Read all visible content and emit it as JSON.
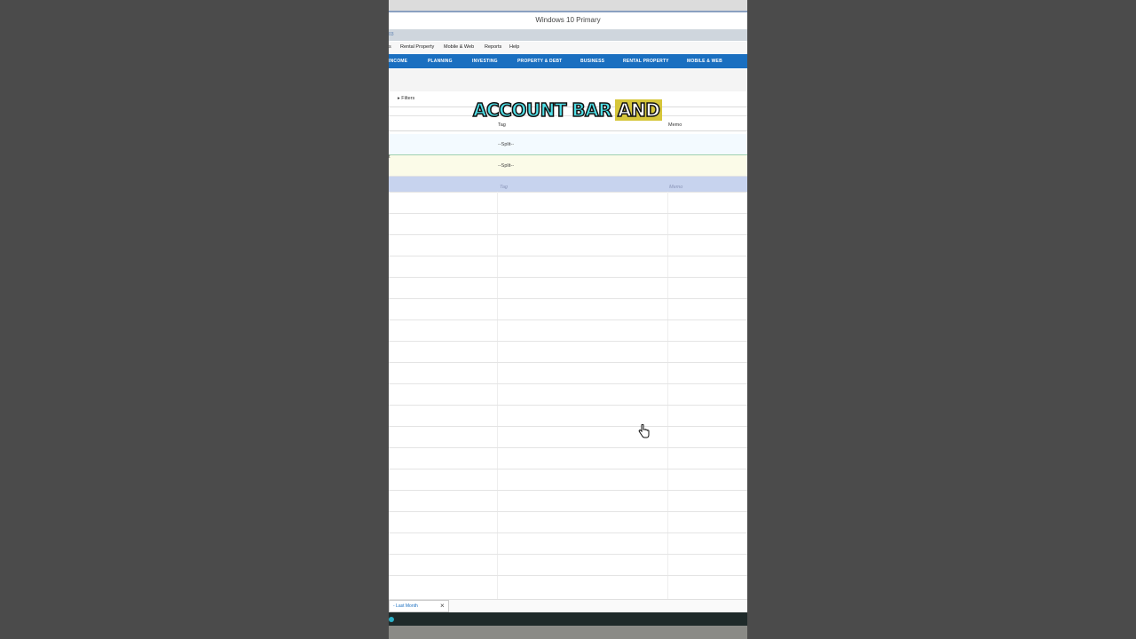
{
  "window": {
    "title": "Windows 10 Primary"
  },
  "menu": {
    "items": [
      "s",
      "Rental Property",
      "Mobile & Web",
      "Reports",
      "Help"
    ],
    "grey_text": "03"
  },
  "nav": {
    "tabs": [
      "INCOME",
      "PLANNING",
      "INVESTING",
      "PROPERTY & DEBT",
      "BUSINESS",
      "RENTAL PROPERTY",
      "MOBILE & WEB"
    ]
  },
  "filters": {
    "label": "Filters"
  },
  "register": {
    "columns": {
      "tag": "Tag",
      "memo": "Memo"
    },
    "rows": [
      {
        "tag": "--Split--",
        "left_mark": ""
      },
      {
        "tag": "--Split--",
        "left_mark": "t"
      }
    ],
    "new_row": {
      "tag": "Tag",
      "memo": "Memo"
    }
  },
  "footer": {
    "tab_label": "- Last Month",
    "close": "×"
  },
  "caption": {
    "word1": "ACCOUNT BAR",
    "word2": "AND"
  },
  "colors": {
    "nav_blue": "#1a6fc0",
    "caption_cyan": "#4fe0e8",
    "caption_highlight": "#d6c63a"
  }
}
